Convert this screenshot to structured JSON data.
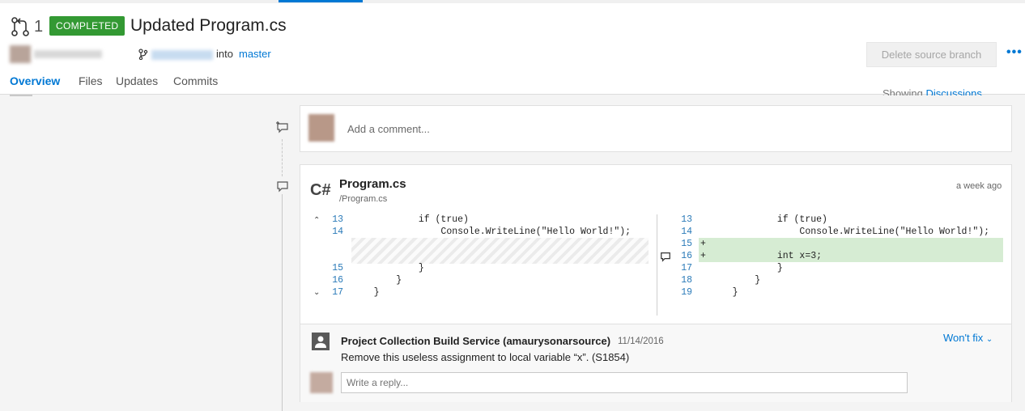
{
  "header": {
    "pr_id": "1",
    "status": "COMPLETED",
    "title": "Updated Program.cs",
    "into_label": "into",
    "target_branch": "master",
    "delete_button": "Delete source branch",
    "more_label": "•••"
  },
  "tabs": [
    {
      "label": "Overview"
    },
    {
      "label": "Files"
    },
    {
      "label": "Updates"
    },
    {
      "label": "Commits"
    }
  ],
  "showing": {
    "prefix": "Showing",
    "link": "Discussions"
  },
  "comment_box": {
    "placeholder": "Add a comment..."
  },
  "file": {
    "icon_label": "C#",
    "name": "Program.cs",
    "path": "/Program.cs",
    "time": "a week ago",
    "left_lines": [
      {
        "num": "13",
        "code": "            if (true)"
      },
      {
        "num": "14",
        "code": "                Console.WriteLine(\"Hello World!\");"
      },
      {
        "num": "15",
        "code": "            }"
      },
      {
        "num": "16",
        "code": "        }"
      },
      {
        "num": "17",
        "code": "    }"
      }
    ],
    "right_lines": [
      {
        "num": "13",
        "code": "            if (true)"
      },
      {
        "num": "14",
        "code": "                Console.WriteLine(\"Hello World!\");"
      },
      {
        "num": "15",
        "code": "",
        "marker": "+"
      },
      {
        "num": "16",
        "code": "            int x=3;",
        "marker": "+"
      },
      {
        "num": "17",
        "code": "            }"
      },
      {
        "num": "18",
        "code": "        }"
      },
      {
        "num": "19",
        "code": "    }"
      }
    ]
  },
  "thread": {
    "author": "Project Collection Build Service (amaurysonarsource)",
    "date": "11/14/2016",
    "text": "Remove this useless assignment to local variable “x”. (S1854)",
    "status": "Won't fix",
    "reply_placeholder": "Write a reply..."
  },
  "colors": {
    "accent": "#0078d4",
    "completed": "#339933",
    "added_line": "#d6ecd3"
  }
}
